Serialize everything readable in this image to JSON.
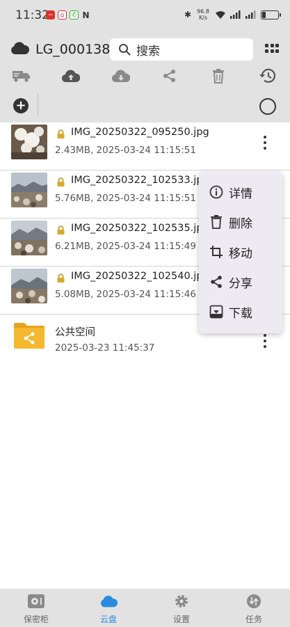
{
  "status_bar": {
    "time": "11:32",
    "network_speed": "96.8 K/s",
    "battery_level": 0.2
  },
  "header": {
    "account_name": "LG_000138",
    "search": {
      "placeholder": "搜索"
    }
  },
  "toolbar": {
    "icons": [
      "transfer-truck-icon",
      "cloud-upload-icon",
      "cloud-download-icon",
      "share-icon",
      "trash-icon",
      "history-icon"
    ]
  },
  "files": [
    {
      "name": "IMG_20250322_095250.jpg",
      "size": "2.43MB",
      "date": "2025-03-24 11:15:51"
    },
    {
      "name": "IMG_20250322_102533.jpg",
      "size": "5.76MB",
      "date": "2025-03-24 11:15:51"
    },
    {
      "name": "IMG_20250322_102535.jpg",
      "size": "6.21MB",
      "date": "2025-03-24 11:15:49"
    },
    {
      "name": "IMG_20250322_102540.jpg",
      "size": "5.08MB",
      "date": "2025-03-24 11:15:46"
    }
  ],
  "file_meta": [
    "2.43MB, 2025-03-24 11:15:51",
    "5.76MB, 2025-03-24 11:15:51",
    "6.21MB, 2025-03-24 11:15:49",
    "5.08MB, 2025-03-24 11:15:46"
  ],
  "folder": {
    "name": "公共空间",
    "date": "2025-03-23 11:45:37"
  },
  "context_menu": {
    "items": [
      {
        "label": "详情",
        "icon": "info-icon"
      },
      {
        "label": "删除",
        "icon": "delete-icon"
      },
      {
        "label": "移动",
        "icon": "crop-move-icon"
      },
      {
        "label": "分享",
        "icon": "share-icon"
      },
      {
        "label": "下载",
        "icon": "download-icon"
      }
    ]
  },
  "bottom_nav": {
    "items": [
      {
        "label": "保密柜",
        "icon": "safe-icon",
        "active": false
      },
      {
        "label": "云盘",
        "icon": "cloud-icon",
        "active": true
      },
      {
        "label": "设置",
        "icon": "gear-icon",
        "active": false
      },
      {
        "label": "任务",
        "icon": "transfer-icon",
        "active": false
      }
    ]
  },
  "colors": {
    "accent": "#2a8cde",
    "bar_background": "#e2e2e2",
    "menu_background": "#eeeaf2",
    "folder": "#f5b82e"
  }
}
